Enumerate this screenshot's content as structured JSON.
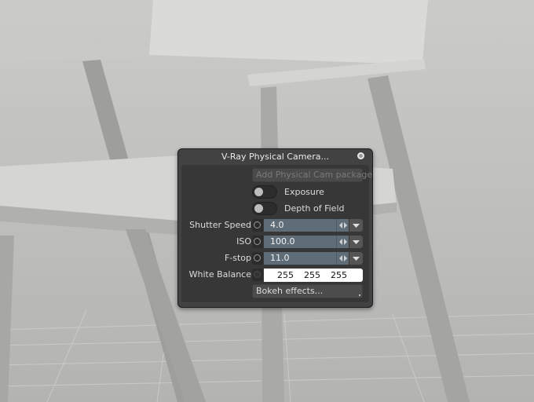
{
  "panel": {
    "title": "V-Ray Physical Camera...",
    "add_package_label": "Add Physical Cam package",
    "exposure_label": "Exposure",
    "dof_label": "Depth of Field",
    "shutter_label": "Shutter Speed",
    "shutter_value": "4.0",
    "iso_label": "ISO",
    "iso_value": "100.0",
    "fstop_label": "F-stop",
    "fstop_value": "11.0",
    "wb_label": "White Balance",
    "wb_r": "255",
    "wb_g": "255",
    "wb_b": "255",
    "bokeh_label": "Bokeh effects..."
  },
  "icons": {
    "pin": "pin-icon",
    "spin": "spin-arrows-icon",
    "dropdown": "dropdown-arrow-icon"
  },
  "colors": {
    "panel_bg": "#424242",
    "field_bg": "#5f6d79",
    "viewport_bg": "#bdbdbb"
  }
}
